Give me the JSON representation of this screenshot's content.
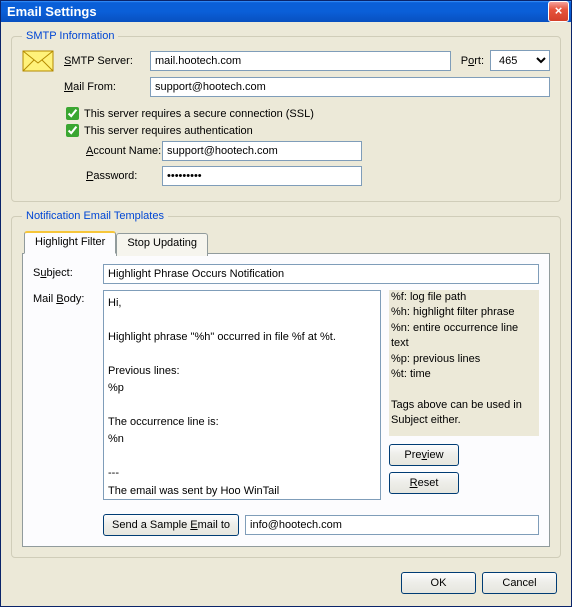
{
  "window": {
    "title": "Email Settings"
  },
  "smtp": {
    "legend": "SMTP Information",
    "server_label": "SMTP Server:",
    "server_value": "mail.hootech.com",
    "port_label": "Port:",
    "port_value": "465",
    "mailfrom_label": "Mail From:",
    "mailfrom_value": "support@hootech.com",
    "ssl_label": "This server requires a secure connection (SSL)",
    "auth_label": "This server requires authentication",
    "account_label": "Account Name:",
    "account_value": "support@hootech.com",
    "password_label": "Password:",
    "password_value": "•••••••••"
  },
  "templates": {
    "legend": "Notification Email Templates",
    "tabs": {
      "highlight": "Highlight Filter",
      "stop": "Stop Updating"
    },
    "subject_label": "Subject:",
    "subject_value": "Highlight Phrase Occurs Notification",
    "mailbody_label": "Mail Body:",
    "mailbody_value": "Hi,\n\nHighlight phrase \"%h\" occurred in file %f at %t.\n\nPrevious lines:\n%p\n\nThe occurrence line is:\n%n\n\n---\nThe email was sent by Hoo WinTail",
    "legend_text": "%f: log file path\n%h: highlight filter phrase\n%n: entire occurrence line text\n%p: previous lines\n%t: time\n\nTags above can be used in Subject either.",
    "preview_btn": "Preview",
    "reset_btn": "Reset",
    "sample_btn": "Send a Sample Email to",
    "sample_value": "info@hootech.com"
  },
  "buttons": {
    "ok": "OK",
    "cancel": "Cancel"
  }
}
